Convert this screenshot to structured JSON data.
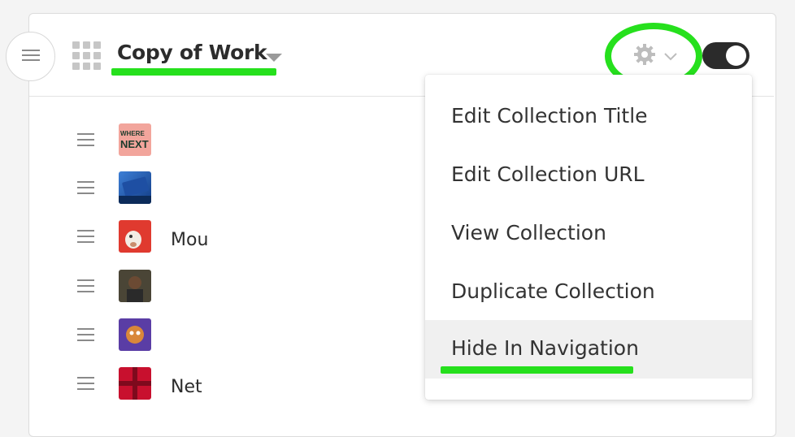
{
  "header": {
    "collection_title": "Copy of Work",
    "menu_icon": "hamburger-icon",
    "apps_icon": "grid-icon",
    "settings_icon": "gear-icon",
    "settings_caret": "chevron-down-icon"
  },
  "toggle": {
    "state": "on"
  },
  "rows": [
    {
      "text": "​",
      "thumb": "where-next-logo"
    },
    {
      "text": "​",
      "thumb": "blue-device"
    },
    {
      "text": "Mou",
      "thumb": "dog-red"
    },
    {
      "text": "​",
      "thumb": "person-photo"
    },
    {
      "text": "​",
      "thumb": "purple-character"
    },
    {
      "text": "Net",
      "thumb": "red-cross"
    }
  ],
  "thumb_labels": {
    "where_top": "WHERE",
    "where_bottom": "NEXT"
  },
  "dropdown": {
    "items": [
      "Edit Collection Title",
      "Edit Collection URL",
      "View Collection",
      "Duplicate Collection",
      "Hide In Navigation"
    ]
  },
  "colors": {
    "annotation": "#26e01d",
    "toggle_bg": "#2b2b2b",
    "highlight": "#f0f0f0"
  }
}
